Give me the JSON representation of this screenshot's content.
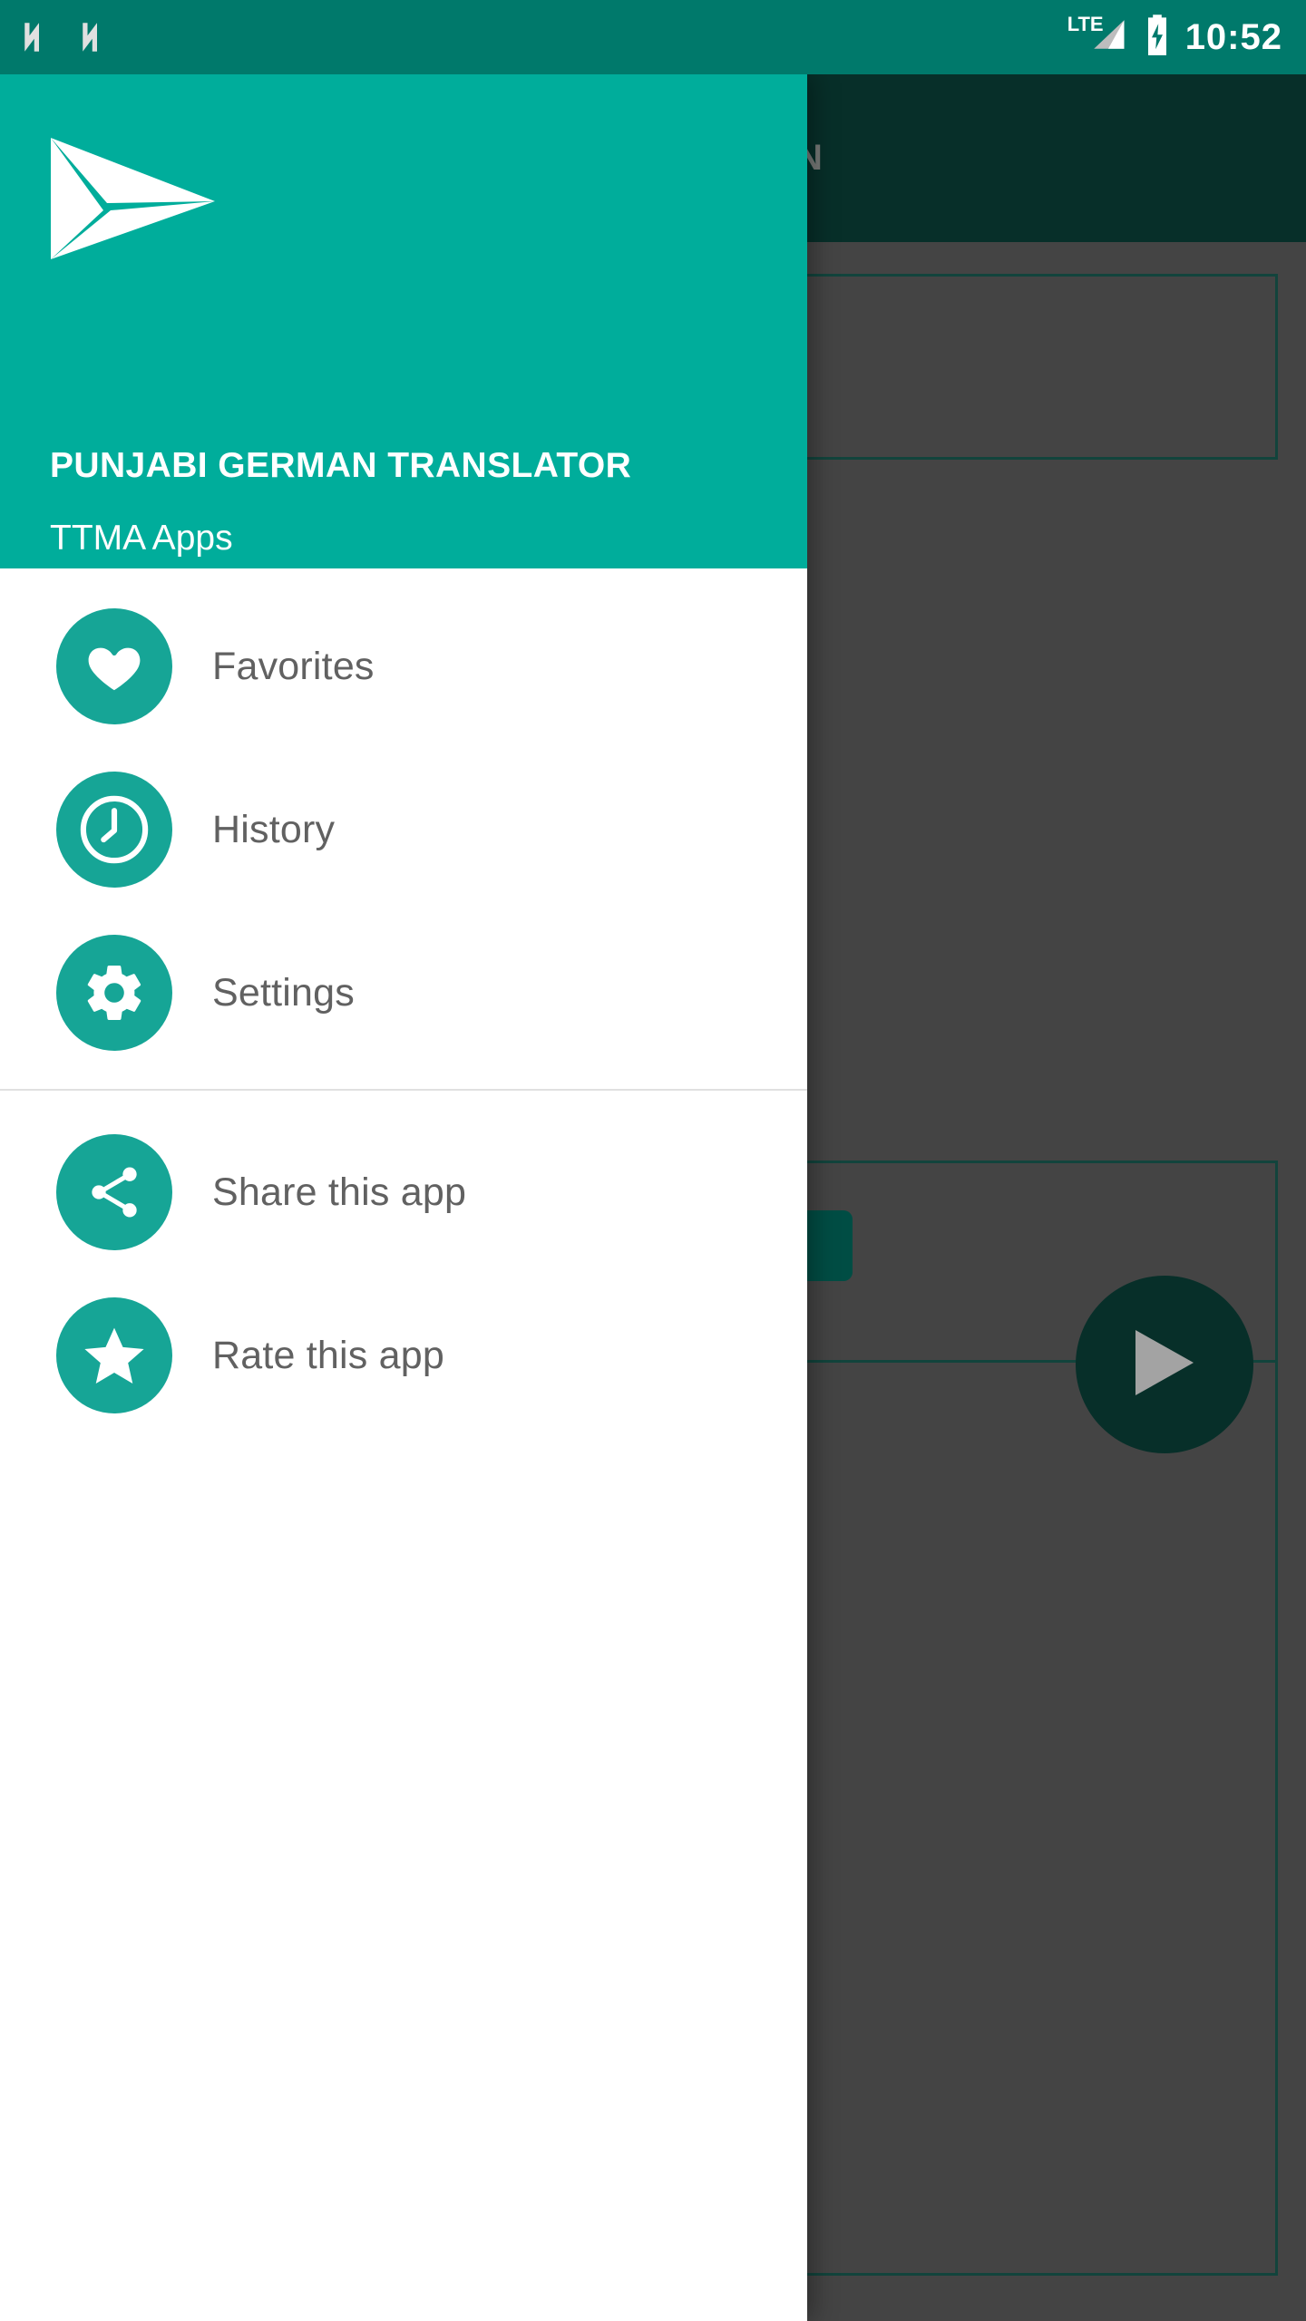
{
  "status_bar": {
    "icons": [
      "n-glyph-icon",
      "n-glyph-icon",
      "lte-icon",
      "signal-icon",
      "battery-charging-icon"
    ],
    "lte_label": "LTE",
    "time": "10:52",
    "background_color": "#00796b"
  },
  "app": {
    "app_bar_title": "GERMAN",
    "app_bar_color": "#0b4a41",
    "accent_color": "#00ad9b",
    "translate_fab_icon": "send-icon"
  },
  "drawer": {
    "header": {
      "logo_icon": "paper-plane-icon",
      "app_name": "PUNJABI GERMAN TRANSLATOR",
      "publisher": "TTMA Apps",
      "background_color": "#00ad9b"
    },
    "groups": [
      {
        "items": [
          {
            "label": "Favorites",
            "icon": "heart-icon"
          },
          {
            "label": "History",
            "icon": "clock-icon"
          },
          {
            "label": "Settings",
            "icon": "gear-icon"
          }
        ]
      },
      {
        "items": [
          {
            "label": "Share this app",
            "icon": "share-icon"
          },
          {
            "label": "Rate this app",
            "icon": "star-icon"
          }
        ]
      }
    ]
  }
}
